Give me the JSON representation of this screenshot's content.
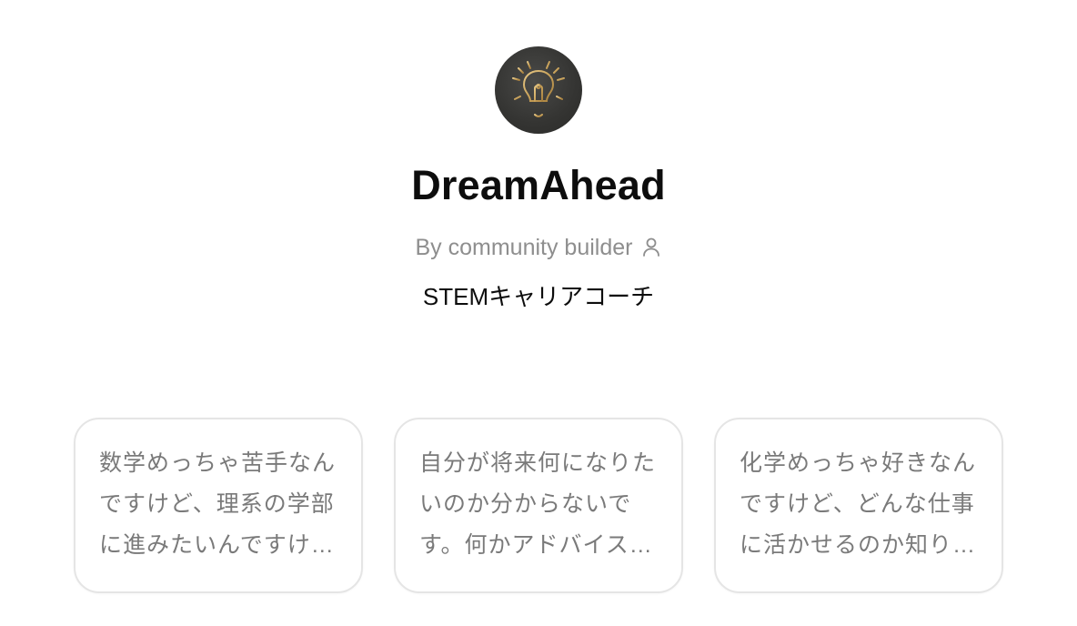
{
  "gpt": {
    "name": "DreamAhead",
    "byline": "By community builder",
    "description": "STEMキャリアコーチ",
    "avatar_icon": "lightbulb-icon",
    "byline_icon": "person-icon",
    "accent_color": "#c9a25a"
  },
  "starters": [
    {
      "text": "数学めっちゃ苦手なんですけど、理系の学部に進みたいんですけど..."
    },
    {
      "text": "自分が将来何になりたいのか分からないです。何かアドバイスください"
    },
    {
      "text": "化学めっちゃ好きなんですけど、どんな仕事に活かせるのか知りたいです"
    }
  ]
}
